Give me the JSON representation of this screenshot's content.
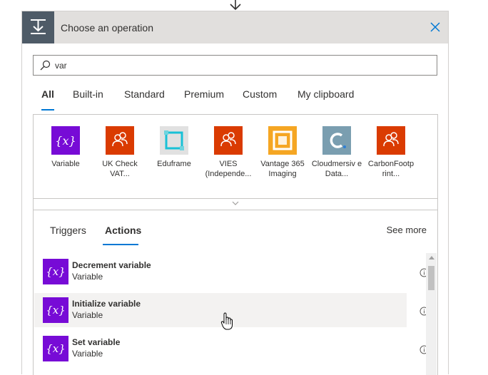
{
  "header": {
    "title": "Choose an operation"
  },
  "search": {
    "value": "var"
  },
  "tabs": [
    {
      "label": "All",
      "active": true
    },
    {
      "label": "Built-in"
    },
    {
      "label": "Standard"
    },
    {
      "label": "Premium"
    },
    {
      "label": "Custom"
    },
    {
      "label": "My clipboard"
    }
  ],
  "connectors": [
    {
      "name": "Variable",
      "icon": "variable-icon",
      "color": "#770bd6"
    },
    {
      "name": "UK Check VAT...",
      "icon": "people-icon",
      "color": "#da3b01"
    },
    {
      "name": "Eduframe",
      "icon": "eduframe-icon",
      "color": "#e1e1e1"
    },
    {
      "name": "VIES (Independe...",
      "icon": "people-icon",
      "color": "#da3b01"
    },
    {
      "name": "Vantage 365 Imaging",
      "icon": "vantage-icon",
      "color": "#f5a623"
    },
    {
      "name": "Cloudmersiv e Data...",
      "icon": "cloudmersive-icon",
      "color": "#7a9eb0"
    },
    {
      "name": "CarbonFootp rint...",
      "icon": "people-icon",
      "color": "#da3b01"
    }
  ],
  "sub_tabs": [
    {
      "label": "Triggers"
    },
    {
      "label": "Actions",
      "active": true
    }
  ],
  "see_more": "See more",
  "actions": [
    {
      "title": "Decrement variable",
      "subtitle": "Variable"
    },
    {
      "title": "Initialize variable",
      "subtitle": "Variable",
      "hovered": true
    },
    {
      "title": "Set variable",
      "subtitle": "Variable"
    }
  ],
  "colors": {
    "accent": "#0078d4",
    "variable": "#770bd6",
    "header_icon": "#4e5b67"
  }
}
